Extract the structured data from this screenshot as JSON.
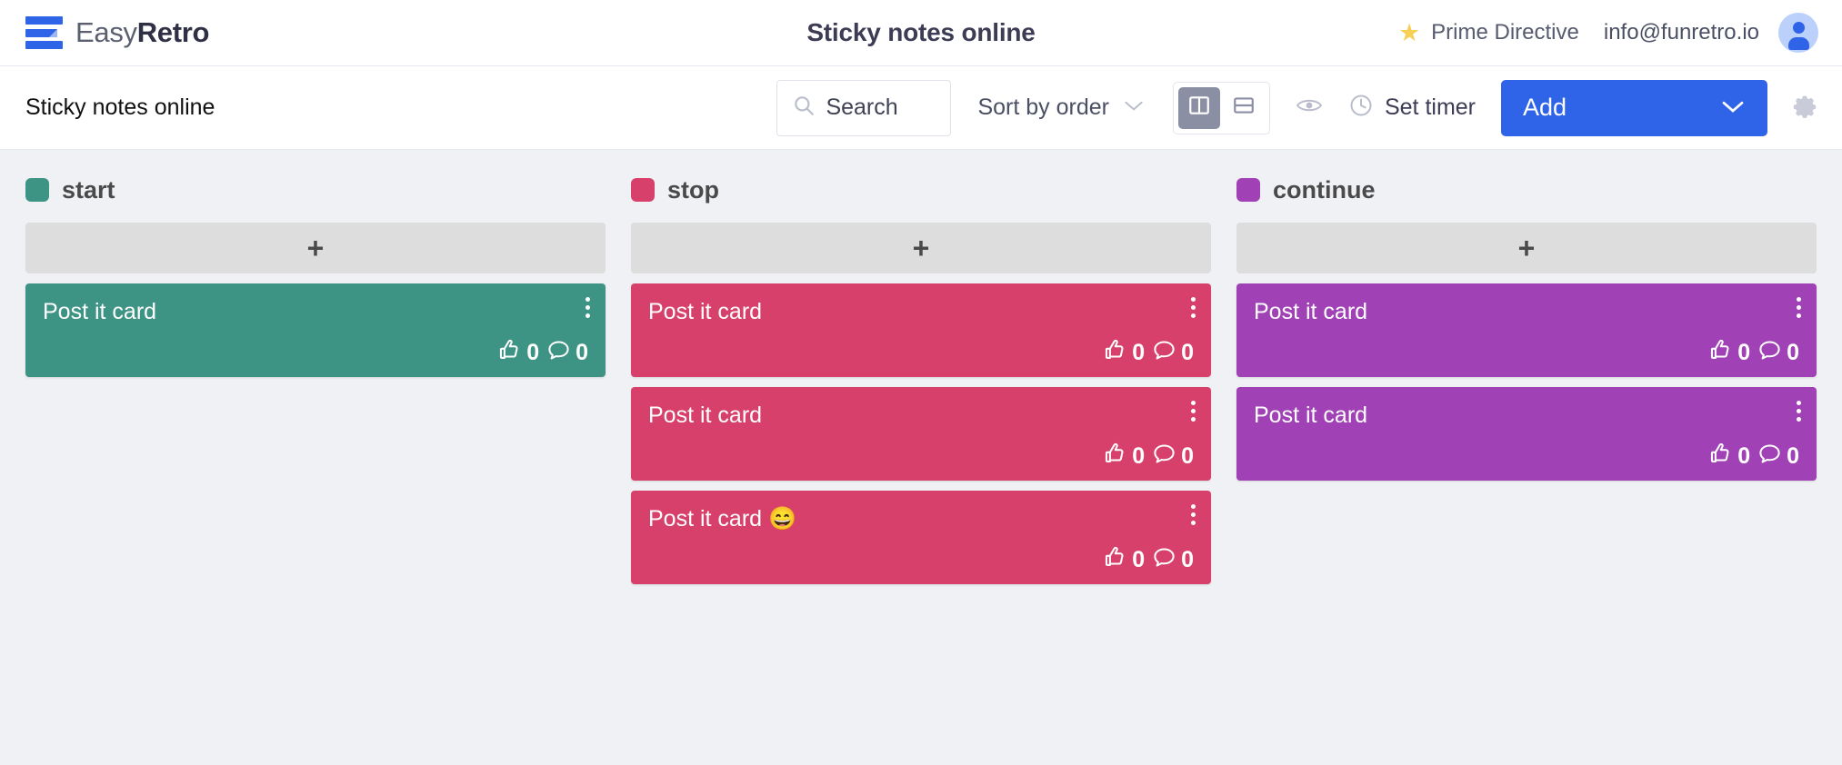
{
  "header": {
    "brand_easy": "Easy",
    "brand_retro": "Retro",
    "title": "Sticky notes online",
    "prime_directive": "Prime Directive",
    "user_email": "info@funretro.io",
    "star_icon": "star-icon",
    "avatar_icon": "user-avatar-icon"
  },
  "toolbar": {
    "board_title": "Sticky notes online",
    "search_placeholder": "Search",
    "sort_label": "Sort by order",
    "timer_label": "Set timer",
    "add_label": "Add",
    "view_columns_icon": "columns-view-icon",
    "view_rows_icon": "rows-view-icon",
    "eye_icon": "eye-icon",
    "clock_icon": "clock-icon",
    "gear_icon": "gear-icon",
    "chevron_icon": "chevron-down-icon",
    "active_view": "columns"
  },
  "colors": {
    "accent_blue": "#2f63e8",
    "start_green": "#3e9484",
    "stop_pink": "#d6406a",
    "continue_purple": "#a041b5",
    "board_bg": "#f0f1f5",
    "add_card_bg": "#dddddd",
    "star_yellow": "#f8cf55"
  },
  "columns": [
    {
      "name": "start",
      "color": "#3e9484",
      "add_label": "+",
      "cards": [
        {
          "text": "Post it card",
          "emoji": "",
          "votes": "0",
          "comments": "0"
        }
      ]
    },
    {
      "name": "stop",
      "color": "#d6406a",
      "add_label": "+",
      "cards": [
        {
          "text": "Post it card",
          "emoji": "",
          "votes": "0",
          "comments": "0"
        },
        {
          "text": "Post it card",
          "emoji": "",
          "votes": "0",
          "comments": "0"
        },
        {
          "text": "Post it card",
          "emoji": "😄",
          "votes": "0",
          "comments": "0"
        }
      ]
    },
    {
      "name": "continue",
      "color": "#a041b5",
      "add_label": "+",
      "cards": [
        {
          "text": "Post it card",
          "emoji": "",
          "votes": "0",
          "comments": "0"
        },
        {
          "text": "Post it card",
          "emoji": "",
          "votes": "0",
          "comments": "0"
        }
      ]
    }
  ]
}
